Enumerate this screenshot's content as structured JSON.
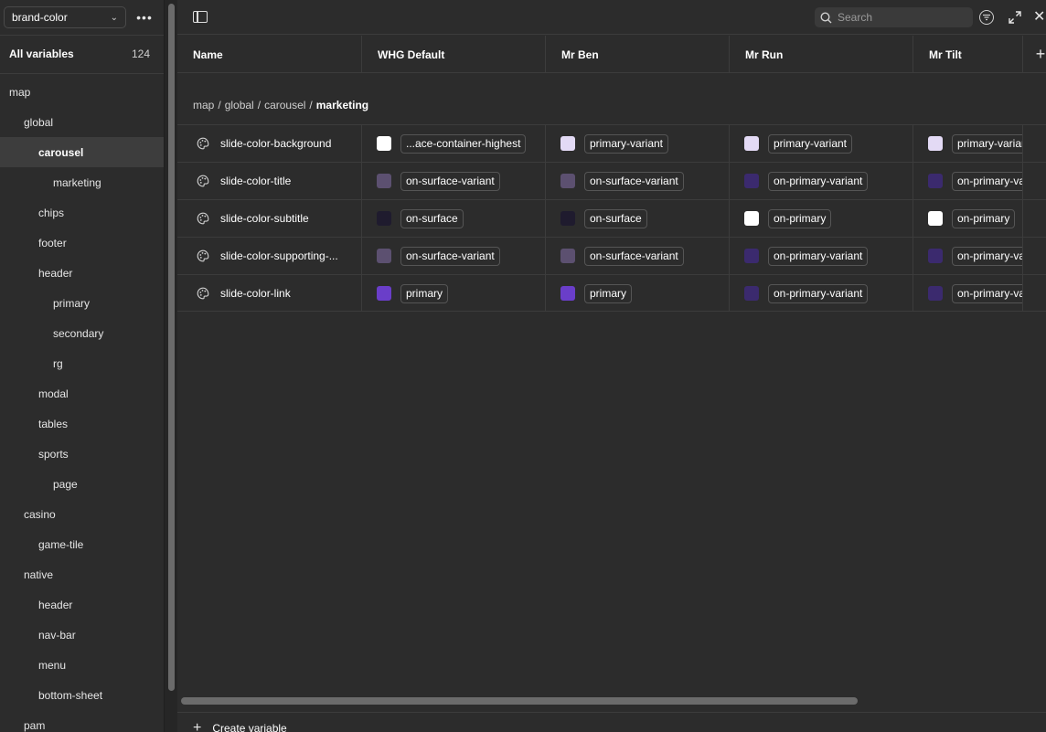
{
  "sidebar": {
    "collection": "brand-color",
    "all_variables_label": "All variables",
    "all_variables_count": "124",
    "tree": [
      {
        "label": "map",
        "depth": 0
      },
      {
        "label": "global",
        "depth": 1
      },
      {
        "label": "carousel",
        "depth": 2,
        "selected": true
      },
      {
        "label": "marketing",
        "depth": 3
      },
      {
        "label": "chips",
        "depth": 2
      },
      {
        "label": "footer",
        "depth": 2
      },
      {
        "label": "header",
        "depth": 2
      },
      {
        "label": "primary",
        "depth": 3
      },
      {
        "label": "secondary",
        "depth": 3
      },
      {
        "label": "rg",
        "depth": 3
      },
      {
        "label": "modal",
        "depth": 2
      },
      {
        "label": "tables",
        "depth": 2
      },
      {
        "label": "sports",
        "depth": 2
      },
      {
        "label": "page",
        "depth": 3
      },
      {
        "label": "casino",
        "depth": 1
      },
      {
        "label": "game-tile",
        "depth": 2
      },
      {
        "label": "native",
        "depth": 1
      },
      {
        "label": "header",
        "depth": 2
      },
      {
        "label": "nav-bar",
        "depth": 2
      },
      {
        "label": "menu",
        "depth": 2
      },
      {
        "label": "bottom-sheet",
        "depth": 2
      },
      {
        "label": "pam",
        "depth": 1
      }
    ]
  },
  "toolbar": {
    "search_placeholder": "Search"
  },
  "columns": [
    "Name",
    "WHG Default",
    "Mr Ben",
    "Mr Run",
    "Mr Tilt"
  ],
  "breadcrumb": {
    "parts": [
      "map",
      "global",
      "carousel"
    ],
    "current": "marketing"
  },
  "colors": {
    "white": "#ffffff",
    "lavender": "#e3daf5",
    "muted_purple": "#5c5070",
    "deep_purple": "#3b2a6e",
    "dark_navy": "#1f1b2e",
    "primary_purple": "#6a3ec9"
  },
  "rows": [
    {
      "name": "slide-color-background",
      "values": [
        {
          "swatch": "#ffffff",
          "label": "...ace-container-highest"
        },
        {
          "swatch": "#e3daf5",
          "label": "primary-variant"
        },
        {
          "swatch": "#e3daf5",
          "label": "primary-variant"
        },
        {
          "swatch": "#e3daf5",
          "label": "primary-variant"
        }
      ]
    },
    {
      "name": "slide-color-title",
      "values": [
        {
          "swatch": "#5c5070",
          "label": "on-surface-variant"
        },
        {
          "swatch": "#5c5070",
          "label": "on-surface-variant"
        },
        {
          "swatch": "#3b2a6e",
          "label": "on-primary-variant"
        },
        {
          "swatch": "#3b2a6e",
          "label": "on-primary-variant"
        }
      ]
    },
    {
      "name": "slide-color-subtitle",
      "values": [
        {
          "swatch": "#1f1b2e",
          "label": "on-surface"
        },
        {
          "swatch": "#1f1b2e",
          "label": "on-surface"
        },
        {
          "swatch": "#ffffff",
          "label": "on-primary"
        },
        {
          "swatch": "#ffffff",
          "label": "on-primary"
        }
      ]
    },
    {
      "name": "slide-color-supporting-...",
      "values": [
        {
          "swatch": "#5c5070",
          "label": "on-surface-variant"
        },
        {
          "swatch": "#5c5070",
          "label": "on-surface-variant"
        },
        {
          "swatch": "#3b2a6e",
          "label": "on-primary-variant"
        },
        {
          "swatch": "#3b2a6e",
          "label": "on-primary-variant"
        }
      ]
    },
    {
      "name": "slide-color-link",
      "values": [
        {
          "swatch": "#6a3ec9",
          "label": "primary"
        },
        {
          "swatch": "#6a3ec9",
          "label": "primary"
        },
        {
          "swatch": "#3b2a6e",
          "label": "on-primary-variant"
        },
        {
          "swatch": "#3b2a6e",
          "label": "on-primary-variant"
        }
      ]
    }
  ],
  "footer": {
    "create_label": "Create variable"
  }
}
